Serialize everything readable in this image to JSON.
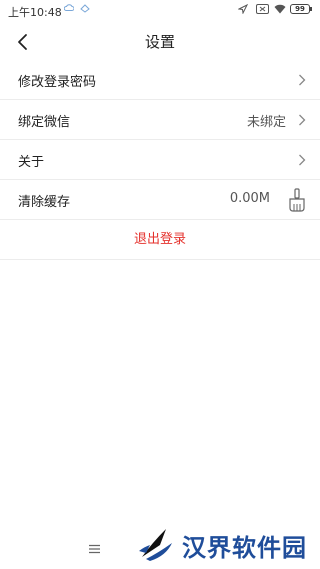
{
  "statusbar": {
    "time": "上午10:48",
    "battery": "99"
  },
  "header": {
    "title": "设置"
  },
  "menu": {
    "change_password": {
      "label": "修改登录密码"
    },
    "bind_wechat": {
      "label": "绑定微信",
      "value": "未绑定"
    },
    "about": {
      "label": "关于"
    },
    "clear_cache": {
      "label": "清除缓存",
      "value": "0.00M"
    }
  },
  "logout": {
    "label": "退出登录"
  },
  "watermark": {
    "text": "汉界软件园"
  },
  "colors": {
    "logout": "#e5322d",
    "watermark": "#1f4d9a"
  }
}
